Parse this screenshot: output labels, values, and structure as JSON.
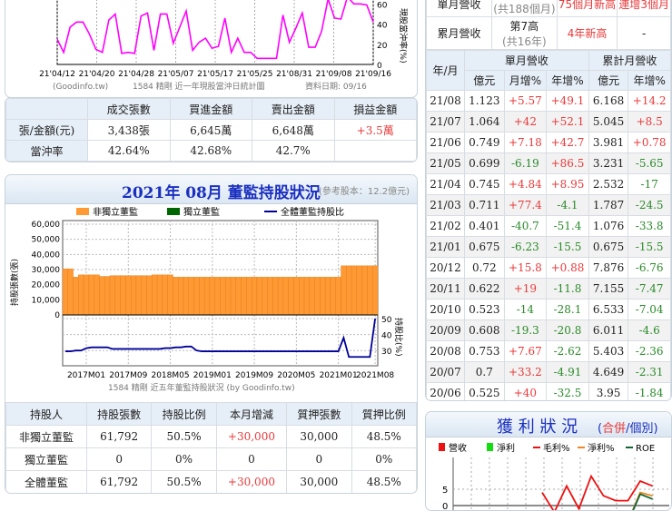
{
  "daytrade_chart": {
    "chart_data": {
      "type": "line",
      "title": "1584 精剛 近一年現股當沖日統計圖",
      "source": "(Goodinfo.tw)",
      "date_label": "資料日期: 09/16",
      "ylabel_right": "現股當沖率(%)",
      "yticks": [
        0,
        20,
        40,
        60
      ],
      "xticks": [
        "21'04/12",
        "21'04/20",
        "21'04/28",
        "21'05/07",
        "21'05/17",
        "21'05/25",
        "21'08/31",
        "21'09/08",
        "21'09/16"
      ],
      "series": [
        {
          "name": "現股當沖率",
          "color": "#ff00ff",
          "values": [
            25,
            12,
            37,
            42,
            42,
            30,
            15,
            12,
            44,
            50,
            11,
            12,
            11,
            48,
            51,
            14,
            50,
            50,
            21,
            37,
            53,
            14,
            22,
            26,
            16,
            18,
            46,
            12,
            26,
            12,
            12,
            6,
            6,
            6,
            6,
            49,
            22,
            36,
            51,
            17,
            17,
            33,
            65,
            46,
            45,
            67,
            60,
            60,
            59,
            42
          ]
        }
      ]
    }
  },
  "daytrade_table": {
    "headers": [
      "",
      "成交張數",
      "買進金額",
      "賣出金額",
      "損益金額"
    ],
    "rows": [
      [
        "張/金額(元)",
        "3,438張",
        "6,645萬",
        "6,648萬",
        "+3.5萬"
      ],
      [
        "當沖率",
        "42.64%",
        "42.68%",
        "42.7%",
        ""
      ]
    ]
  },
  "directors": {
    "title": "2021年 08月 董監持股狀況",
    "note": "(參考股本：12.2億元)",
    "legend": [
      "非獨立董監",
      "獨立董監",
      "全體董監持股比"
    ],
    "chart_data": {
      "type": "bar",
      "ylabel": "持股張數(張)",
      "ylabel_right": "持股比(%)",
      "yticks": [
        "0",
        "10,000",
        "20,000",
        "30,000",
        "40,000",
        "50,000",
        "60,000"
      ],
      "ylim": [
        0,
        60000
      ],
      "ratio_ticks": [
        "30",
        "40",
        "50"
      ],
      "xticks": [
        "2017M01",
        "2017M09",
        "2018M05",
        "2019M01",
        "2019M09",
        "2020M05",
        "2021M01",
        "2021M08"
      ],
      "caption": "1584 精剛 近五年董監持股狀況 (by Goodinfo.tw)",
      "bars": [
        30500,
        30500,
        25000,
        26500,
        26500,
        26500,
        26500,
        25500,
        25500,
        26000,
        26000,
        26000,
        26000,
        26000,
        26000,
        26000,
        26000,
        26500,
        26500,
        26500,
        26500,
        25000,
        25000,
        25000,
        25000,
        25000,
        25000,
        25000,
        25000,
        25000,
        25000,
        25000,
        25000,
        25000,
        25000,
        25000,
        25000,
        25000,
        25000,
        25000,
        25000,
        25000,
        25000,
        25000,
        25000,
        25000,
        25000,
        25000,
        25000,
        25000,
        25000,
        25000,
        25000,
        32500,
        32500,
        32500,
        32500,
        32500,
        32500,
        32500
      ],
      "ratio": [
        29.5,
        29.5,
        30,
        30,
        31.5,
        32,
        32,
        32,
        32,
        31,
        31,
        31,
        31,
        31,
        31,
        31,
        31,
        31,
        31,
        31.5,
        31.5,
        32,
        32,
        32.5,
        32.5,
        30,
        29.5,
        29.5,
        29.5,
        29.5,
        29.5,
        29.5,
        29.5,
        29.5,
        29.5,
        29.5,
        29.5,
        29.5,
        29.5,
        29.5,
        29.5,
        29.5,
        29.5,
        29.5,
        29.5,
        29.5,
        29.5,
        29.5,
        29.5,
        29.5,
        29.5,
        29.5,
        29.5,
        38,
        26,
        26,
        26,
        26,
        26,
        50
      ]
    },
    "headers": [
      "持股人",
      "持股張數",
      "持股比例",
      "本月增減",
      "質押張數",
      "質押比例"
    ],
    "rows": [
      [
        "非獨立董監",
        "61,792",
        "50.5%",
        "+30,000",
        "30,000",
        "48.5%"
      ],
      [
        "獨立董監",
        "0",
        "0%",
        "0",
        "0",
        "0%"
      ],
      [
        "全體董監",
        "61,792",
        "50.5%",
        "+30,000",
        "30,000",
        "48.5%"
      ]
    ]
  },
  "revenue_summary": {
    "rows": [
      [
        "單月營收",
        "(共188個月)",
        "75個月新高",
        "連增3個月"
      ],
      [
        "累月營收",
        "第7高",
        "(共16年)",
        "4年新高",
        "-"
      ]
    ]
  },
  "revenue": {
    "h_month": "年/月",
    "h_single": "單月營收",
    "h_cum": "累計月營收",
    "sub": [
      "億元",
      "月增%",
      "年增%",
      "億元",
      "年增%"
    ],
    "rows": [
      [
        "21/08",
        "1.123",
        "+5.57",
        "+49.1",
        "6.168",
        "+14.2"
      ],
      [
        "21/07",
        "1.064",
        "+42",
        "+52.1",
        "5.045",
        "+8.5"
      ],
      [
        "21/06",
        "0.749",
        "+7.18",
        "+42.7",
        "3.981",
        "+0.78"
      ],
      [
        "21/05",
        "0.699",
        "-6.19",
        "+86.5",
        "3.231",
        "-5.65"
      ],
      [
        "21/04",
        "0.745",
        "+4.84",
        "+8.95",
        "2.532",
        "-17"
      ],
      [
        "21/03",
        "0.711",
        "+77.4",
        "-4.1",
        "1.787",
        "-24.5"
      ],
      [
        "21/02",
        "0.401",
        "-40.7",
        "-51.4",
        "1.076",
        "-33.8"
      ],
      [
        "21/01",
        "0.675",
        "-6.23",
        "-15.5",
        "0.675",
        "-15.5"
      ],
      [
        "20/12",
        "0.72",
        "+15.8",
        "+0.88",
        "7.876",
        "-6.76"
      ],
      [
        "20/11",
        "0.622",
        "+19",
        "-11.8",
        "7.155",
        "-7.47"
      ],
      [
        "20/10",
        "0.523",
        "-14",
        "-28.1",
        "6.533",
        "-7.04"
      ],
      [
        "20/09",
        "0.608",
        "-19.3",
        "-20.8",
        "6.011",
        "-4.6"
      ],
      [
        "20/08",
        "0.753",
        "+7.67",
        "-2.62",
        "5.403",
        "-2.36"
      ],
      [
        "20/07",
        "0.7",
        "+33.2",
        "-4.91",
        "4.649",
        "-2.31"
      ],
      [
        "20/06",
        "0.525",
        "+40",
        "-32.5",
        "3.95",
        "-1.84"
      ]
    ]
  },
  "profit": {
    "title": "獲 利 狀 況",
    "open": "(",
    "consolidated": "合併",
    "sep": "/",
    "individual": "個別",
    "close": ")",
    "legend": [
      "營收",
      "淨利",
      "毛利%",
      "淨利%",
      "ROE"
    ],
    "chart_data": {
      "type": "line",
      "yticks": [
        "5",
        "0"
      ],
      "series": [
        {
          "name": "毛利%",
          "color": "#ee1111",
          "values": [
            4,
            -2,
            6,
            -1,
            9,
            3,
            1.5,
            1.5,
            7.5,
            6
          ]
        },
        {
          "name": "淨利%",
          "color": "#ee8822",
          "values": [
            null,
            null,
            null,
            null,
            -2,
            null,
            null,
            -5,
            4,
            3
          ]
        },
        {
          "name": "ROE",
          "color": "#116633",
          "values": [
            null,
            null,
            null,
            null,
            0,
            null,
            null,
            -5,
            3.5,
            2
          ]
        }
      ]
    }
  }
}
